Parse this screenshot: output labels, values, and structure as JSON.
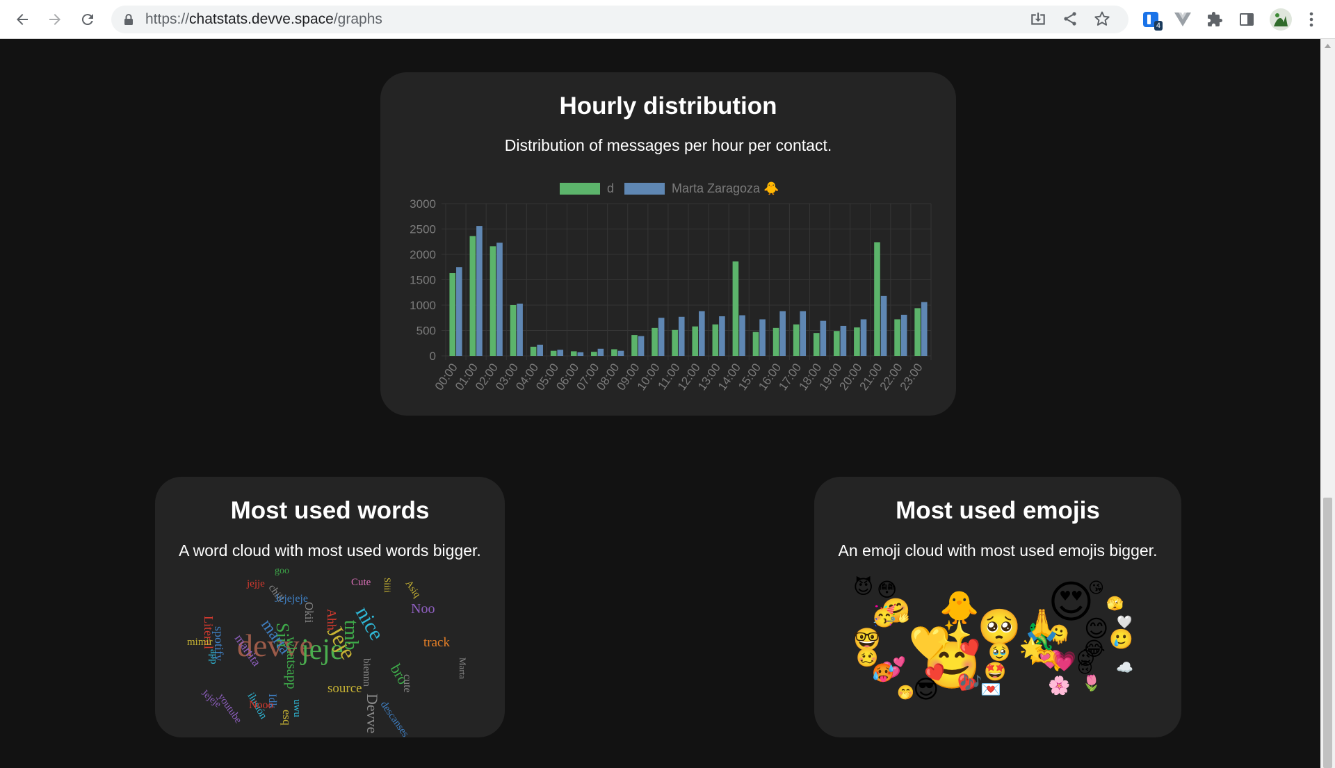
{
  "browser": {
    "url_scheme": "https://",
    "url_host": "chatstats.devve.space",
    "url_path": "/graphs",
    "extension_badge": "4"
  },
  "hourly": {
    "title": "Hourly distribution",
    "description": "Distribution of messages per hour per contact.",
    "legend": [
      "d",
      "Marta Zaragoza 🐥"
    ]
  },
  "chart_data": {
    "type": "bar",
    "categories": [
      "00:00",
      "01:00",
      "02:00",
      "03:00",
      "04:00",
      "05:00",
      "06:00",
      "07:00",
      "08:00",
      "09:00",
      "10:00",
      "11:00",
      "12:00",
      "13:00",
      "14:00",
      "15:00",
      "16:00",
      "17:00",
      "18:00",
      "19:00",
      "20:00",
      "21:00",
      "22:00",
      "23:00"
    ],
    "series": [
      {
        "name": "d",
        "color": "#5cb46b",
        "values": [
          1630,
          2360,
          2160,
          1000,
          180,
          100,
          90,
          80,
          130,
          410,
          550,
          510,
          580,
          620,
          1860,
          470,
          550,
          620,
          450,
          490,
          560,
          2240,
          720,
          940
        ]
      },
      {
        "name": "Marta Zaragoza 🐥",
        "color": "#5f87b3",
        "values": [
          1750,
          2560,
          2230,
          1030,
          220,
          120,
          70,
          140,
          100,
          390,
          750,
          770,
          880,
          780,
          800,
          720,
          880,
          880,
          690,
          590,
          720,
          1180,
          810,
          1060
        ]
      }
    ],
    "ylim": [
      0,
      3000
    ],
    "yticks": [
      0,
      500,
      1000,
      1500,
      2000,
      2500,
      3000
    ],
    "grid": true,
    "legend_position": "top"
  },
  "words": {
    "title": "Most used words",
    "description": "A word cloud with most used words bigger.",
    "cloud": [
      {
        "text": "devve",
        "color": "#9c5b49"
      },
      {
        "text": "jeje",
        "color": "#4bae4f"
      },
      {
        "text": "Jeje",
        "color": "#c8b434"
      },
      {
        "text": "nice",
        "color": "#2fb7d6"
      },
      {
        "text": "tmb",
        "color": "#3eaa4a"
      },
      {
        "text": "Siii",
        "color": "#3eaa4a"
      },
      {
        "text": "marta",
        "color": "#3f7fc2"
      },
      {
        "text": "spotify",
        "color": "#3f7fc2"
      },
      {
        "text": "Literal",
        "color": "#d63a2f"
      },
      {
        "text": "jejje",
        "color": "#d63a2f"
      },
      {
        "text": "chill",
        "color": "#8a8a8a"
      },
      {
        "text": "goo",
        "color": "#3eaa4a"
      },
      {
        "text": "Jejejeje",
        "color": "#3f7fc2"
      },
      {
        "text": "Okii",
        "color": "#8a8a8a"
      },
      {
        "text": "Ahh",
        "color": "#d63a2f"
      },
      {
        "text": "Cute",
        "color": "#d96fb6"
      },
      {
        "text": "Siiii",
        "color": "#c8b434"
      },
      {
        "text": "Asiq",
        "color": "#c8b434"
      },
      {
        "text": "Noo",
        "color": "#8e5fbf"
      },
      {
        "text": "track",
        "color": "#e57f27"
      },
      {
        "text": "martita",
        "color": "#8e5fbf"
      },
      {
        "text": "whatsapp",
        "color": "#3eaa4a"
      },
      {
        "text": "mimir",
        "color": "#c8b434"
      },
      {
        "text": "app",
        "color": "#2fb7d6"
      },
      {
        "text": "biennn",
        "color": "#8a8a8a"
      },
      {
        "text": "bro",
        "color": "#3eaa4a"
      },
      {
        "text": "Devve",
        "color": "#8a8a8a"
      },
      {
        "text": "cute",
        "color": "#8a8a8a"
      },
      {
        "text": "Marta",
        "color": "#8a8a8a"
      },
      {
        "text": "youtube",
        "color": "#8e5fbf"
      },
      {
        "text": "ilusión",
        "color": "#2fb7d6"
      },
      {
        "text": "Idk",
        "color": "#3f7fc2"
      },
      {
        "text": "uwu",
        "color": "#2fb7d6"
      },
      {
        "text": "esq",
        "color": "#c8b434"
      },
      {
        "text": "source",
        "color": "#c8b434"
      },
      {
        "text": "descanses",
        "color": "#3f7fc2"
      },
      {
        "text": "Jejeje",
        "color": "#8e5fbf"
      },
      {
        "text": "Nooo",
        "color": "#d63a2f"
      },
      {
        "text": "satelec",
        "color": "#d96fb6"
      }
    ]
  },
  "emojis": {
    "title": "Most used emojis",
    "description": "An emoji cloud with most used emojis bigger.",
    "cloud": [
      "😍",
      "🥰",
      "🥺",
      "😊",
      "💛",
      "✨",
      "🐥",
      "🤗",
      "😳",
      "😈",
      "🥳",
      "🤓",
      "😘",
      "💘",
      "😎",
      "💕",
      "🥹",
      "🫶",
      "🦎",
      "💌",
      "🌸",
      "🌷",
      "☁️",
      "🤭",
      "🫠",
      "🥲",
      "😂",
      "🙏",
      "💗",
      "🌟",
      "😉",
      "🫣",
      "🤍",
      "🥵",
      "🙃",
      "🤩",
      "🥴",
      "🎶"
    ]
  }
}
